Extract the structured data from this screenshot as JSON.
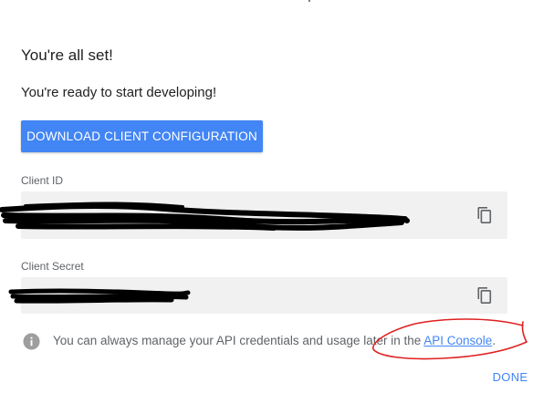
{
  "dialog": {
    "title": "You're all set!",
    "subtitle": "You're ready to start developing!",
    "download_button": "DOWNLOAD CLIENT CONFIGURATION",
    "client_id": {
      "label": "Client ID",
      "value": "",
      "copy_icon": "copy-icon"
    },
    "client_secret": {
      "label": "Client Secret",
      "value": "",
      "copy_icon": "copy-icon"
    },
    "info": {
      "icon": "info-icon",
      "text": "You can always manage your API credentials and usage later in the ",
      "link": "API Console",
      "suffix": "."
    },
    "done_button": "DONE"
  },
  "colors": {
    "accent": "#4285f4",
    "field_bg": "#f1f1f1",
    "redaction": "#000000",
    "annotation": "#e02020"
  }
}
